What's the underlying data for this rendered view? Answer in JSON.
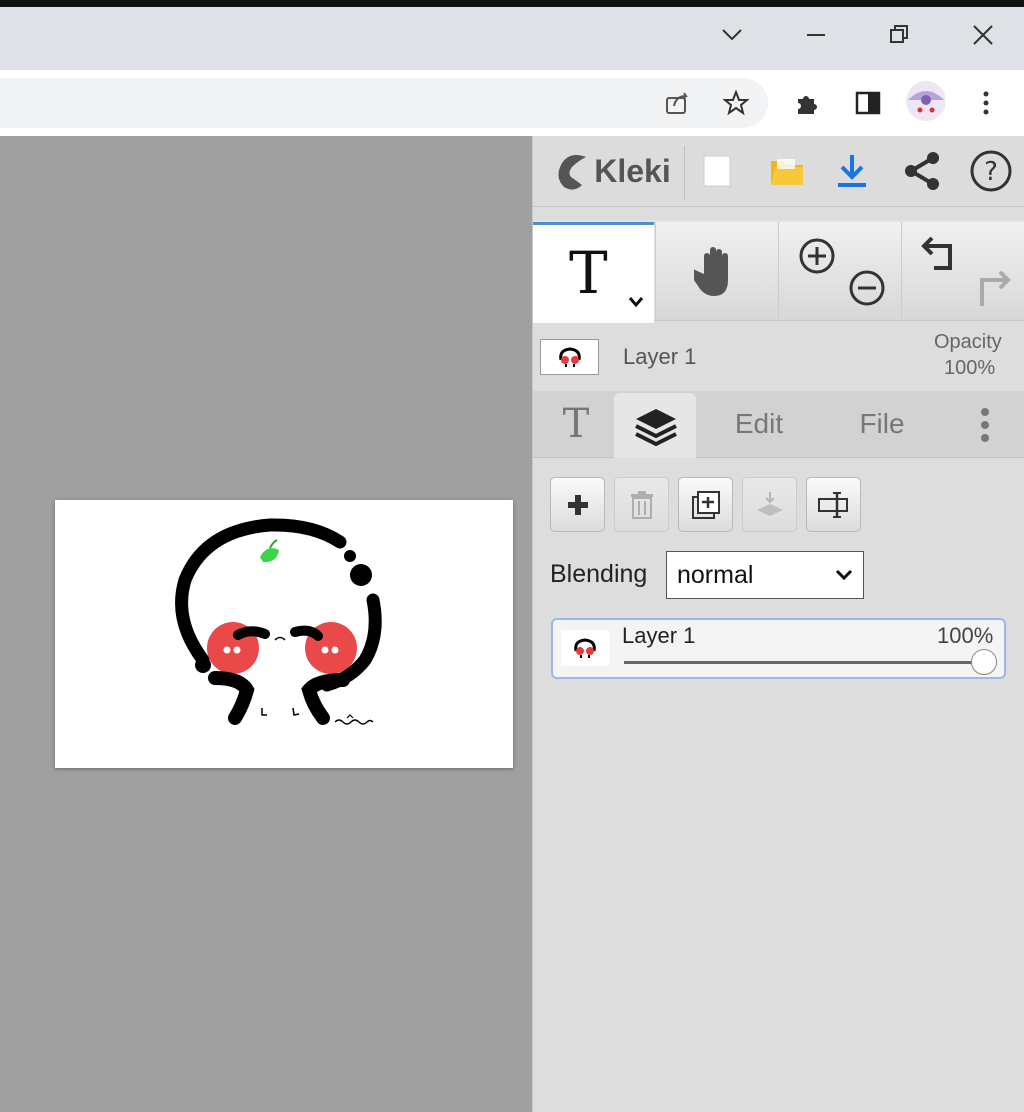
{
  "browser": {
    "window_controls": [
      "chevron-down",
      "minimize",
      "restore",
      "close"
    ],
    "toolbar_icons": [
      "share-icon",
      "star-icon",
      "extensions-icon",
      "sidepanel-icon",
      "profile-avatar",
      "menu-icon"
    ]
  },
  "app": {
    "name": "Kleki",
    "header_buttons": [
      "new-file",
      "open-file",
      "download",
      "share",
      "help"
    ]
  },
  "tools": {
    "active_tool_glyph": "T",
    "items": [
      "text-tool",
      "hand-tool",
      "zoom-in",
      "zoom-out",
      "undo",
      "redo"
    ]
  },
  "current_layer": {
    "name": "Layer 1",
    "opacity_label": "Opacity",
    "opacity_value": "100%"
  },
  "tabs": {
    "text_glyph": "T",
    "edit": "Edit",
    "file": "File"
  },
  "layers_panel": {
    "blending_label": "Blending",
    "blending_value": "normal",
    "layers": [
      {
        "name": "Layer 1",
        "opacity": "100%",
        "opacity_fraction": 1.0
      }
    ]
  },
  "colors": {
    "accent": "#4a90d9",
    "canvas_bg": "#a0a0a0",
    "panel_bg": "#dddddd",
    "download_blue": "#1a73e8",
    "folder_yellow": "#f2b619"
  }
}
